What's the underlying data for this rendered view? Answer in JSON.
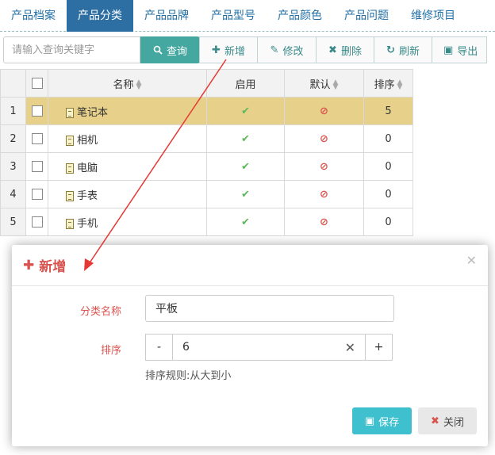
{
  "tabs": [
    {
      "label": "产品档案"
    },
    {
      "label": "产品分类"
    },
    {
      "label": "产品品牌"
    },
    {
      "label": "产品型号"
    },
    {
      "label": "产品颜色"
    },
    {
      "label": "产品问题"
    },
    {
      "label": "维修项目"
    }
  ],
  "active_tab": "产品分类",
  "toolbar": {
    "search_placeholder": "请输入查询关键字",
    "query_label": "查询",
    "add_label": "新增",
    "edit_label": "修改",
    "delete_label": "删除",
    "refresh_label": "刷新",
    "export_label": "导出"
  },
  "grid": {
    "columns": {
      "name": "名称",
      "enabled": "启用",
      "default": "默认",
      "sort": "排序"
    },
    "rows": [
      {
        "index": "1",
        "name": "笔记本",
        "enabled": true,
        "default": false,
        "sort": "5",
        "selected": true
      },
      {
        "index": "2",
        "name": "相机",
        "enabled": true,
        "default": false,
        "sort": "0",
        "selected": false
      },
      {
        "index": "3",
        "name": "电脑",
        "enabled": true,
        "default": false,
        "sort": "0",
        "selected": false
      },
      {
        "index": "4",
        "name": "手表",
        "enabled": true,
        "default": false,
        "sort": "0",
        "selected": false
      },
      {
        "index": "5",
        "name": "手机",
        "enabled": true,
        "default": false,
        "sort": "0",
        "selected": false
      }
    ]
  },
  "modal": {
    "title": "新增",
    "name_label": "分类名称",
    "name_value": "平板",
    "sort_label": "排序",
    "sort_value": "6",
    "minus": "-",
    "plus": "+",
    "hint": "排序规则:从大到小",
    "save_label": "保存",
    "close_label": "关闭"
  },
  "colors": {
    "accent": "#2d6fa3",
    "query_button": "#44a8a0",
    "selected_row": "#e7d18a",
    "danger": "#d9534f",
    "save_button": "#3fc0cf"
  }
}
